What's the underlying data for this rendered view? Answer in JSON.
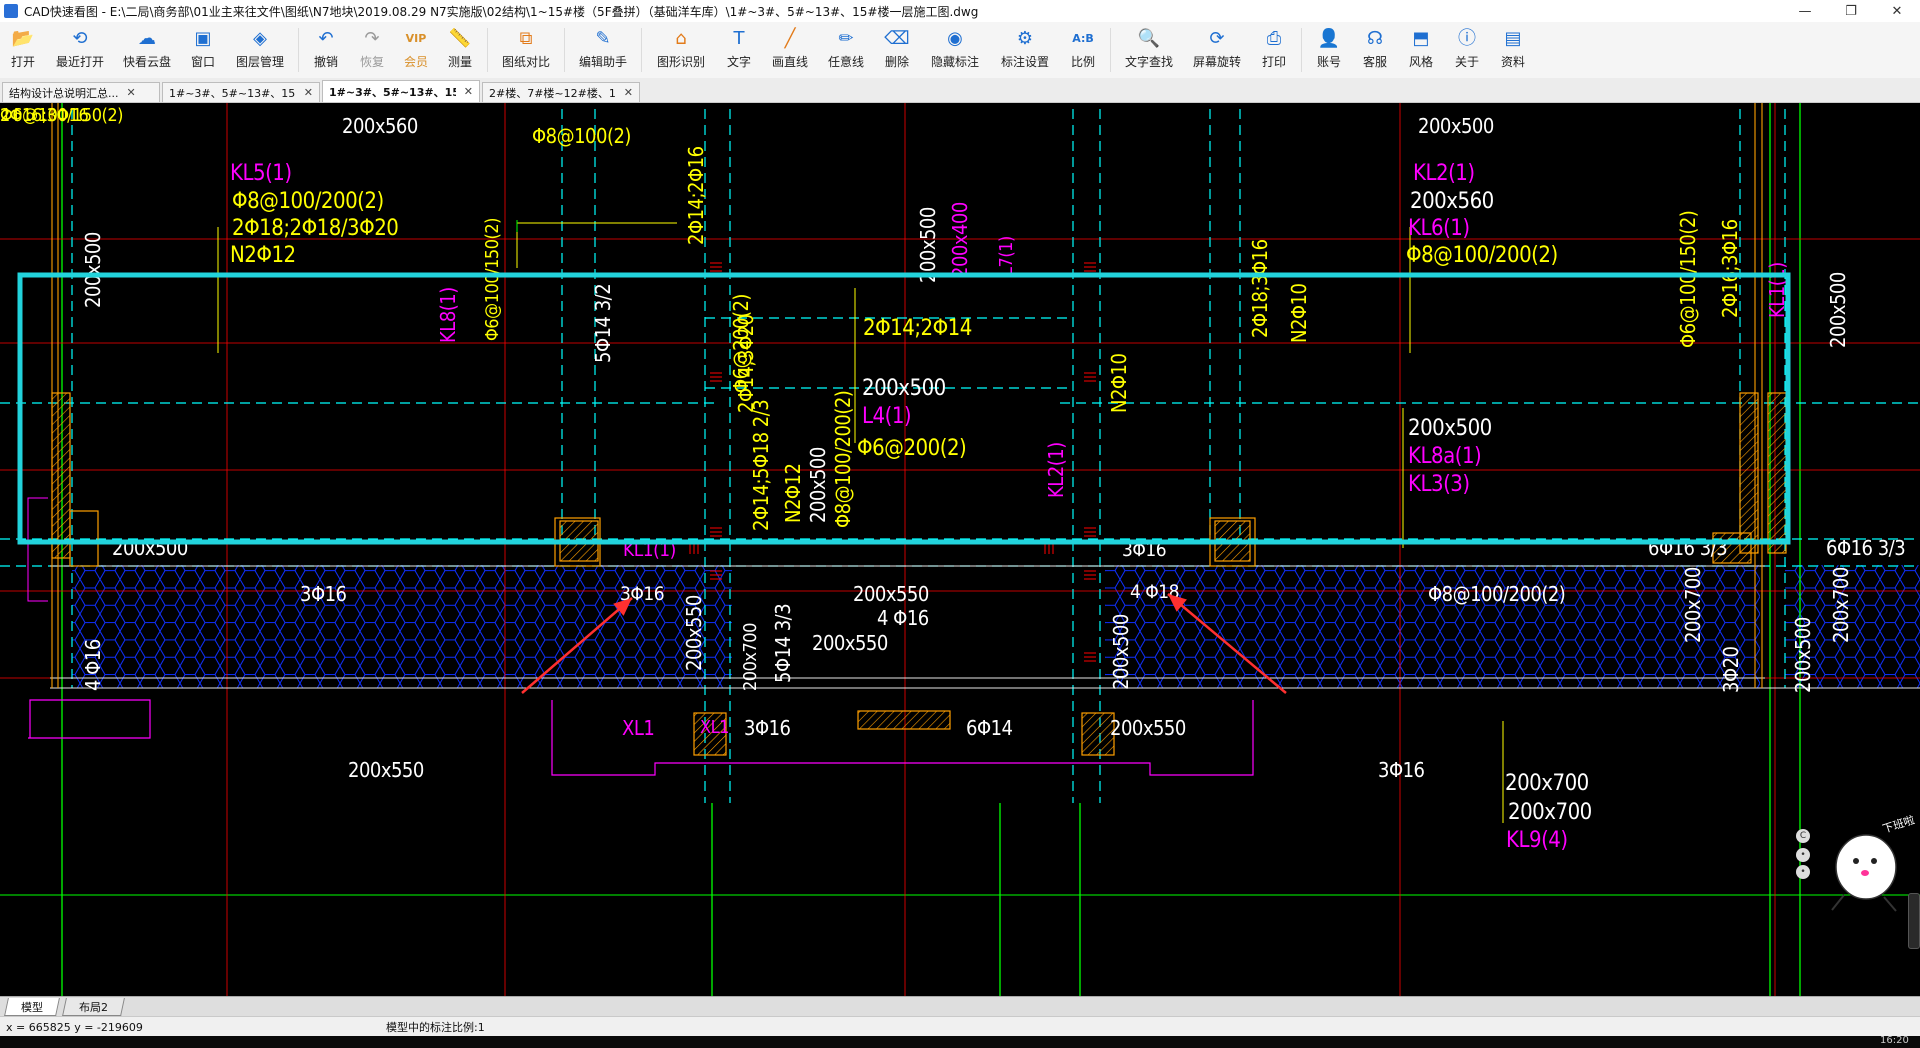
{
  "window": {
    "title": "CAD快速看图 - E:\\二局\\商务部\\01业主来往文件\\图纸\\N7地块\\2019.08.29 N7实施版\\02结构\\1~15#楼（5F叠拼）（基础洋车库）\\1#~3#、5#~13#、15#楼一层施工图.dwg",
    "minimize": "—",
    "restore": "❐",
    "close": "✕"
  },
  "toolbar": [
    {
      "label": "打开",
      "icon": "folder-open-icon",
      "glyph": "📂",
      "color": "#1f6fd1"
    },
    {
      "label": "最近打开",
      "icon": "recent-icon",
      "glyph": "⟲",
      "color": "#1f6fd1"
    },
    {
      "label": "快看云盘",
      "icon": "cloud-icon",
      "glyph": "☁",
      "color": "#1f6fd1"
    },
    {
      "label": "窗口",
      "icon": "window-icon",
      "glyph": "▣",
      "color": "#1f6fd1"
    },
    {
      "label": "图层管理",
      "icon": "layers-icon",
      "glyph": "◈",
      "color": "#1f6fd1"
    },
    {
      "sep": true
    },
    {
      "label": "撤销",
      "icon": "undo-icon",
      "glyph": "↶",
      "color": "#1f6fd1"
    },
    {
      "label": "恢复",
      "icon": "redo-icon",
      "glyph": "↷",
      "color": "#9a9a9a",
      "disabled": true
    },
    {
      "label": "会员",
      "icon": "vip-icon",
      "glyph": "VIP",
      "color": "#d9902a",
      "vip": true
    },
    {
      "label": "测量",
      "icon": "measure-icon",
      "glyph": "📏",
      "color": "#1f6fd1"
    },
    {
      "sep": true
    },
    {
      "label": "图纸对比",
      "icon": "compare-icon",
      "glyph": "⧉",
      "color": "#e27b1a"
    },
    {
      "sep": true
    },
    {
      "label": "编辑助手",
      "icon": "edit-assistant-icon",
      "glyph": "✎",
      "color": "#1f6fd1"
    },
    {
      "sep": true
    },
    {
      "label": "图形识别",
      "icon": "shape-recognize-icon",
      "glyph": "⌂",
      "color": "#e27b1a"
    },
    {
      "label": "文字",
      "icon": "text-icon",
      "glyph": "T",
      "color": "#1f6fd1"
    },
    {
      "label": "画直线",
      "icon": "line-icon",
      "glyph": "╱",
      "color": "#e27b1a"
    },
    {
      "label": "任意线",
      "icon": "pen-icon",
      "glyph": "✏",
      "color": "#1f6fd1"
    },
    {
      "label": "删除",
      "icon": "eraser-icon",
      "glyph": "⌫",
      "color": "#1f6fd1"
    },
    {
      "label": "隐藏标注",
      "icon": "hide-annotation-icon",
      "glyph": "◉",
      "color": "#1f6fd1"
    },
    {
      "label": "标注设置",
      "icon": "annotation-settings-icon",
      "glyph": "⚙",
      "color": "#1f6fd1"
    },
    {
      "label": "比例",
      "icon": "scale-icon",
      "glyph": "A:B",
      "color": "#1f6fd1"
    },
    {
      "sep": true
    },
    {
      "label": "文字查找",
      "icon": "text-search-icon",
      "glyph": "🔍",
      "color": "#1f6fd1"
    },
    {
      "label": "屏幕旋转",
      "icon": "rotate-screen-icon",
      "glyph": "⟳",
      "color": "#1f6fd1"
    },
    {
      "label": "打印",
      "icon": "print-icon",
      "glyph": "⎙",
      "color": "#1f6fd1"
    },
    {
      "sep": true
    },
    {
      "label": "账号",
      "icon": "account-icon",
      "glyph": "👤",
      "color": "#1f6fd1"
    },
    {
      "label": "客服",
      "icon": "headset-icon",
      "glyph": "☊",
      "color": "#1f6fd1"
    },
    {
      "label": "风格",
      "icon": "style-icon",
      "glyph": "⬒",
      "color": "#1f6fd1"
    },
    {
      "label": "关于",
      "icon": "info-icon",
      "glyph": "ⓘ",
      "color": "#1f6fd1"
    },
    {
      "label": "资料",
      "icon": "docs-icon",
      "glyph": "▤",
      "color": "#1f6fd1"
    }
  ],
  "tabs": [
    {
      "label": "结构设计总说明汇总...",
      "active": false
    },
    {
      "label": "1#~3#、5#~13#、15#...",
      "active": false
    },
    {
      "label": "1#~3#、5#~13#、15#...",
      "active": true
    },
    {
      "label": "2#楼、7#楼~12#楼、1...",
      "active": false
    }
  ],
  "layout_tabs": [
    "模型",
    "布局2"
  ],
  "status": {
    "coords": "x = 665825  y = -219609",
    "scale_text": "模型中的标注比例:1",
    "clock": "16:20"
  },
  "colors": {
    "magenta": "#ff00ff",
    "yellow": "#ffff00",
    "white": "#ffffff",
    "cyan": "#00ffff",
    "blue": "#0000ff",
    "red": "#ff0000",
    "orange": "#ff9f00",
    "green": "#00ff00",
    "highlight": "#22d3dc",
    "arrow": "#ff3030"
  },
  "drawing": {
    "labels": [
      {
        "text": "200x560",
        "color": "white"
      },
      {
        "text": "Φ8@100(2)",
        "color": "yellow"
      },
      {
        "text": "KL5(1)",
        "color": "magenta"
      },
      {
        "text": "Φ8@100/200(2)",
        "color": "yellow"
      },
      {
        "text": "2Φ18;2Φ18/3Φ20",
        "color": "yellow"
      },
      {
        "text": "N2Φ12",
        "color": "yellow"
      },
      {
        "text": "200x500",
        "color": "white"
      },
      {
        "text": "KL8(1)",
        "color": "magenta"
      },
      {
        "text": "Φ6@100/150(2)",
        "color": "yellow"
      },
      {
        "text": "2Φ14;2Φ16",
        "color": "yellow"
      },
      {
        "text": "5Φ14  3/2",
        "color": "white"
      },
      {
        "text": "200x500",
        "color": "white"
      },
      {
        "text": "200x400",
        "color": "magenta"
      },
      {
        "text": "L7(1)",
        "color": "magenta"
      },
      {
        "text": "Φ6@200(2)",
        "color": "yellow"
      },
      {
        "text": "2Φ14;2Φ14",
        "color": "yellow"
      },
      {
        "text": "200x500",
        "color": "white"
      },
      {
        "text": "L4(1)",
        "color": "magenta"
      },
      {
        "text": "Φ6@200(2)",
        "color": "yellow"
      },
      {
        "text": "2Φ14;3Φ20",
        "color": "yellow"
      },
      {
        "text": "N2Φ12",
        "color": "yellow"
      },
      {
        "text": "200x500",
        "color": "white"
      },
      {
        "text": "Φ8@100/200(2)",
        "color": "yellow"
      },
      {
        "text": "2Φ14;5Φ18 2/3",
        "color": "yellow"
      },
      {
        "text": "N2Φ10",
        "color": "yellow"
      },
      {
        "text": "KL2(1)",
        "color": "magenta"
      },
      {
        "text": "200x500",
        "color": "white"
      },
      {
        "text": "KL2(1)",
        "color": "magenta"
      },
      {
        "text": "200x560",
        "color": "white"
      },
      {
        "text": "KL6(1)",
        "color": "magenta"
      },
      {
        "text": "Φ8@100/200(2)",
        "color": "yellow"
      },
      {
        "text": "2Φ18;3Φ16",
        "color": "yellow"
      },
      {
        "text": "N2Φ10",
        "color": "yellow"
      },
      {
        "text": "200x500",
        "color": "white"
      },
      {
        "text": "KL8a(1)",
        "color": "magenta"
      },
      {
        "text": "KL3(3)",
        "color": "magenta"
      },
      {
        "text": "Φ6@100/150(2)",
        "color": "yellow"
      },
      {
        "text": "2Φ16;3Φ16",
        "color": "yellow"
      },
      {
        "text": "KL1(1)",
        "color": "magenta"
      },
      {
        "text": "200x500",
        "color": "white"
      },
      {
        "text": "200x500",
        "color": "white"
      },
      {
        "text": "KL1(1)",
        "color": "magenta"
      },
      {
        "text": "3Φ16",
        "color": "white"
      },
      {
        "text": "6Φ16 3/3",
        "color": "white"
      },
      {
        "text": "6Φ16 3/3",
        "color": "white"
      },
      {
        "text": "3Φ16",
        "color": "white"
      },
      {
        "text": "3Φ16",
        "color": "white"
      },
      {
        "text": "200x550",
        "color": "white"
      },
      {
        "text": "4 Φ16",
        "color": "white"
      },
      {
        "text": "200x550",
        "color": "white"
      },
      {
        "text": "4 Φ18",
        "color": "white"
      },
      {
        "text": "Φ8@100/200(2)",
        "color": "white"
      },
      {
        "text": "4 Φ16",
        "color": "white"
      },
      {
        "text": "200x550",
        "color": "white"
      },
      {
        "text": "200x700",
        "color": "white"
      },
      {
        "text": "5Φ14  3/3",
        "color": "white"
      },
      {
        "text": "200x500",
        "color": "white"
      },
      {
        "text": "3Φ20",
        "color": "white"
      },
      {
        "text": "200x500",
        "color": "white"
      },
      {
        "text": "200x700",
        "color": "white"
      },
      {
        "text": "200x700",
        "color": "white"
      },
      {
        "text": "XL1",
        "color": "magenta"
      },
      {
        "text": "XL1",
        "color": "magenta"
      },
      {
        "text": "3Φ16",
        "color": "white"
      },
      {
        "text": "6Φ14",
        "color": "white"
      },
      {
        "text": "200x550",
        "color": "white"
      },
      {
        "text": "200x550",
        "color": "white"
      },
      {
        "text": "3Φ16",
        "color": "white"
      },
      {
        "text": "200x700",
        "color": "white"
      },
      {
        "text": "200x700",
        "color": "white"
      },
      {
        "text": "KL9(4)",
        "color": "magenta"
      },
      {
        "text": "Φ6@100/150(2)",
        "color": "yellow"
      },
      {
        "text": "2Φ16;3Φ16",
        "color": "yellow"
      }
    ]
  },
  "mascot_badge": "下班啦"
}
